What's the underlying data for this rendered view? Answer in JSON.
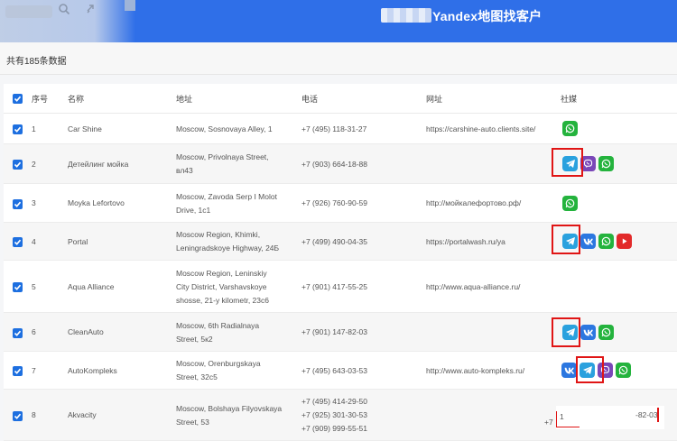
{
  "header": {
    "title": "Yandex地图找客户"
  },
  "subheader": {
    "count_text": "共有185条数据"
  },
  "columns": {
    "index": "序号",
    "name": "名称",
    "address": "地址",
    "phone": "电话",
    "website": "网址",
    "social": "社媒"
  },
  "rows": [
    {
      "index": "1",
      "name": "Car Shine",
      "address": [
        "Moscow, Sosnovaya Alley, 1"
      ],
      "phones": [
        "+7 (495) 118-31-27"
      ],
      "website": "https://carshine-auto.clients.site/",
      "social": [
        "whatsapp"
      ]
    },
    {
      "index": "2",
      "name": "Детейлинг мойка",
      "address": [
        "Moscow, Privolnaya Street,",
        "вл43"
      ],
      "phones": [
        "+7 (903) 664-18-88"
      ],
      "website": "",
      "social": [
        "telegram",
        "viber",
        "whatsapp"
      ]
    },
    {
      "index": "3",
      "name": "Moyka Lefortovo",
      "address": [
        "Moscow, Zavoda Serp I Molot",
        "Drive, 1c1"
      ],
      "phones": [
        "+7 (926) 760-90-59"
      ],
      "website": "http://мойкалефортово.рф/",
      "social": [
        "whatsapp"
      ]
    },
    {
      "index": "4",
      "name": "Portal",
      "address": [
        "Moscow Region, Khimki,",
        "Leningradskoye Highway, 24Б"
      ],
      "phones": [
        "+7 (499) 490-04-35"
      ],
      "website": "https://portalwash.ru/ya",
      "social": [
        "telegram",
        "vk",
        "whatsapp",
        "youtube"
      ]
    },
    {
      "index": "5",
      "name": "Aqua Alliance",
      "address": [
        "Moscow Region, Leninskiy",
        "City District, Varshavskoye",
        "shosse, 21-y kilometr, 23с6"
      ],
      "phones": [
        "+7 (901) 417-55-25"
      ],
      "website": "http://www.aqua-alliance.ru/",
      "social": []
    },
    {
      "index": "6",
      "name": "CleanAuto",
      "address": [
        "Moscow, 6th Radialnaya",
        "Street, 5к2"
      ],
      "phones": [
        "+7 (901) 147-82-03"
      ],
      "website": "",
      "social": [
        "telegram",
        "vk",
        "whatsapp"
      ]
    },
    {
      "index": "7",
      "name": "AutoKompleks",
      "address": [
        "Moscow, Orenburgskaya",
        "Street, 32с5"
      ],
      "phones": [
        "+7 (495) 643-03-53"
      ],
      "website": "http://www.auto-kompleks.ru/",
      "social": [
        "vk",
        "telegram",
        "viber",
        "whatsapp"
      ]
    },
    {
      "index": "8",
      "name": "Akvacity",
      "address": [
        "Moscow, Bolshaya Filyovskaya",
        "Street, 53"
      ],
      "phones": [
        "+7 (495) 414-29-50",
        "+7 (925) 301-30-53",
        "+7 (909) 999-55-51"
      ],
      "website": "",
      "social": []
    }
  ],
  "overlay": {
    "left_text": "+7",
    "mid_text": "1",
    "right_text": "-82-03"
  },
  "icons": {
    "whatsapp": "whatsapp-icon",
    "telegram": "telegram-icon",
    "viber": "viber-icon",
    "vk": "vk-icon",
    "youtube": "youtube-icon"
  },
  "colors": {
    "accent": "#2f6fe8",
    "checkbox": "#1d6fe0",
    "highlight": "#e01515"
  }
}
